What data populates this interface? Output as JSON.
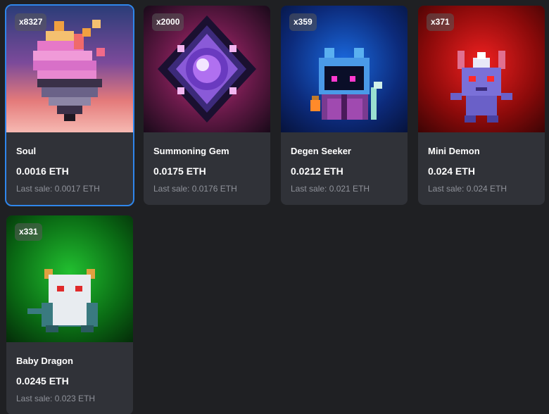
{
  "items": [
    {
      "name": "Soul",
      "count": "x8327",
      "price": "0.0016 ETH",
      "last_sale": "Last sale: 0.0017 ETH",
      "icon": "soul-flame-icon",
      "selected": true
    },
    {
      "name": "Summoning Gem",
      "count": "x2000",
      "price": "0.0175 ETH",
      "last_sale": "Last sale: 0.0176 ETH",
      "icon": "summoning-gem-icon",
      "selected": false
    },
    {
      "name": "Degen Seeker",
      "count": "x359",
      "price": "0.0212 ETH",
      "last_sale": "Last sale: 0.021 ETH",
      "icon": "degen-seeker-icon",
      "selected": false
    },
    {
      "name": "Mini Demon",
      "count": "x371",
      "price": "0.024 ETH",
      "last_sale": "Last sale: 0.024 ETH",
      "icon": "mini-demon-icon",
      "selected": false
    },
    {
      "name": "Baby Dragon",
      "count": "x331",
      "price": "0.0245 ETH",
      "last_sale": "Last sale: 0.023 ETH",
      "icon": "baby-dragon-icon",
      "selected": false
    }
  ],
  "colors": {
    "background": "#1f2023",
    "card": "#303238",
    "selected_outline": "#2f86eb",
    "muted_text": "#8f929a"
  }
}
